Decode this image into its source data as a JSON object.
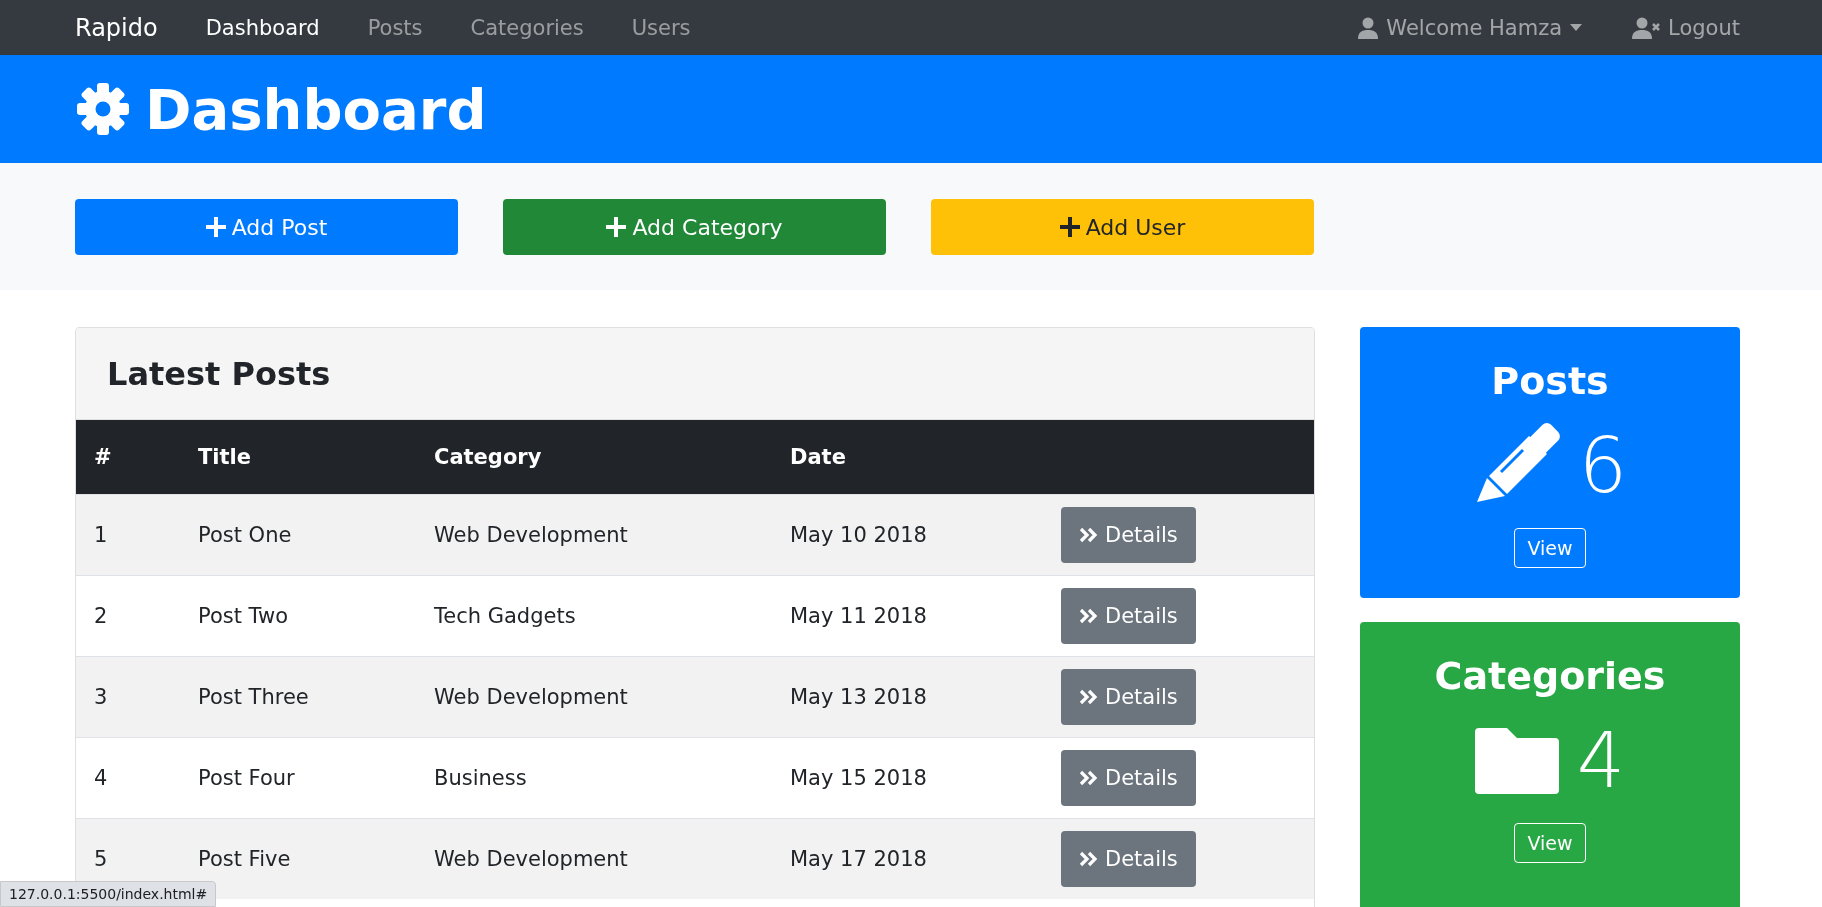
{
  "navbar": {
    "brand": "Rapido",
    "links": [
      {
        "label": "Dashboard",
        "selected": true
      },
      {
        "label": "Posts",
        "selected": false
      },
      {
        "label": "Categories",
        "selected": false
      },
      {
        "label": "Users",
        "selected": false
      }
    ],
    "user_menu": "Welcome Hamza",
    "logout": "Logout"
  },
  "header": {
    "title": "Dashboard"
  },
  "actions": [
    {
      "label": "Add Post",
      "kind": "primary"
    },
    {
      "label": "Add Category",
      "kind": "success"
    },
    {
      "label": "Add User",
      "kind": "warning"
    }
  ],
  "latest_posts": {
    "title": "Latest Posts",
    "columns": [
      "#",
      "Title",
      "Category",
      "Date"
    ],
    "rows": [
      {
        "number": "1",
        "title": "Post One",
        "category": "Web Development",
        "date": "May 10 2018",
        "button": "Details"
      },
      {
        "number": "2",
        "title": "Post Two",
        "category": "Tech Gadgets",
        "date": "May 11 2018",
        "button": "Details"
      },
      {
        "number": "3",
        "title": "Post Three",
        "category": "Web Development",
        "date": "May 13 2018",
        "button": "Details"
      },
      {
        "number": "4",
        "title": "Post Four",
        "category": "Business",
        "date": "May 15 2018",
        "button": "Details"
      },
      {
        "number": "5",
        "title": "Post Five",
        "category": "Web Development",
        "date": "May 17 2018",
        "button": "Details"
      }
    ]
  },
  "stats": [
    {
      "kind": "posts",
      "title": "Posts",
      "count": "6",
      "button": "View"
    },
    {
      "kind": "categories",
      "title": "Categories",
      "count": "4",
      "button": "View"
    }
  ],
  "status_bar": {
    "url": "127.0.0.1:5500/index.html#"
  }
}
